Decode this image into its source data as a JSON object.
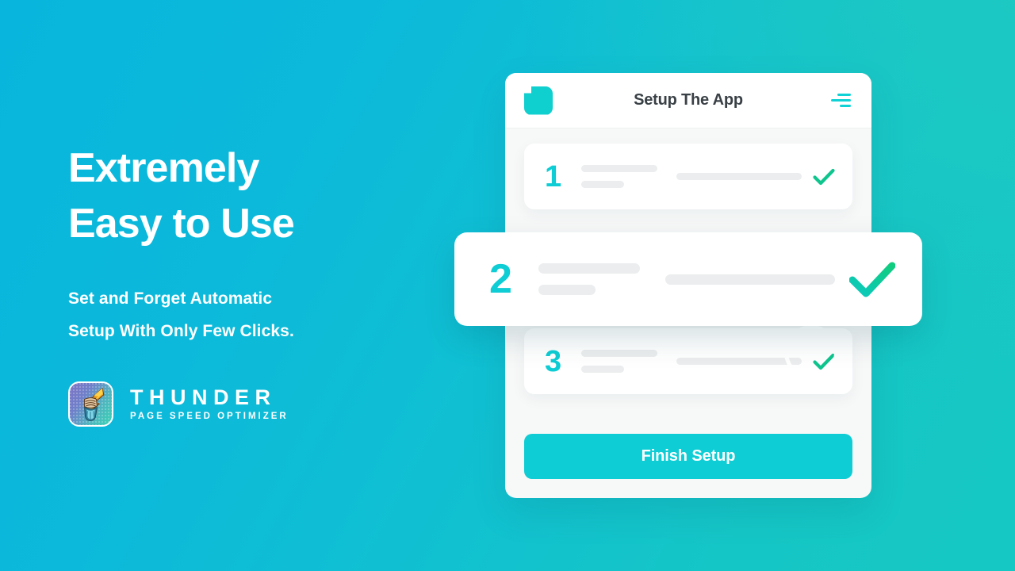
{
  "theme": {
    "bg_gradient_from": "#08b6dd",
    "bg_gradient_to": "#16c8c3",
    "accent_teal": "#0ecdd4",
    "check_green": "#0fc58e",
    "skeleton_gray": "#ebedee",
    "title_gray": "#3a4146"
  },
  "left": {
    "headline_line1": "Extremely",
    "headline_line2": "Easy to Use",
    "subhead_line1": "Set and Forget Automatic",
    "subhead_line2": "Setup With Only Few Clicks.",
    "logo": {
      "icon_name": "fist-holding-lightning-bolt-icon",
      "name": "THUNDER",
      "tagline": "PAGE SPEED OPTIMIZER"
    }
  },
  "app": {
    "header": {
      "logo_icon": "app-square-logo-icon",
      "title": "Setup The App",
      "menu_icon": "hamburger-menu-icon"
    },
    "steps": [
      {
        "number": "1",
        "status_icon": "check-icon",
        "highlighted": false
      },
      {
        "number": "2",
        "status_icon": "check-icon",
        "highlighted": true
      },
      {
        "number": "3",
        "status_icon": "check-icon",
        "highlighted": false
      }
    ],
    "finish_button_label": "Finish Setup"
  }
}
